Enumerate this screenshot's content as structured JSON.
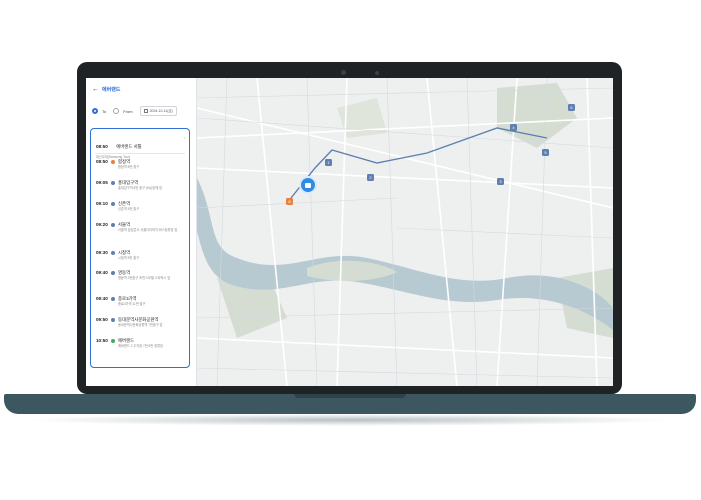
{
  "header": {
    "back_icon": "arrow-left-icon",
    "title": "에버랜드"
  },
  "filters": {
    "to_label": "To",
    "from_label": "From",
    "date_value": "2024-10-11(금)",
    "selected": "To"
  },
  "route": {
    "start": {
      "time": "08:50",
      "name": "에버랜드 서틀",
      "desc": "대산우대(Samsung Tour)"
    },
    "stops": [
      {
        "time": "08:50",
        "name": "합정역",
        "desc": "합정역 8번 출구",
        "color": "#e9803d"
      },
      {
        "time": "09:05",
        "name": "홍대입구역",
        "desc": "홍대입구역 8번 출구 (KA)앞에 정",
        "color": "#5f7fb0"
      },
      {
        "time": "09:10",
        "name": "신촌역",
        "desc": "신촌역 5번 출구",
        "color": "#5f7fb0"
      },
      {
        "time": "09:20",
        "name": "서울역",
        "desc": "서울역 빌딩콘으 서울다리하차 버스정류장 앞",
        "color": "#5f7fb0"
      },
      {
        "time": "09:30",
        "name": "시청역",
        "desc": "시청역 5번 출구",
        "color": "#5f7fb0"
      },
      {
        "time": "09:40",
        "name": "명동역",
        "desc": "명동역 2번출구 조핀스모텔 스타벅스 앞",
        "color": "#5f7fb0"
      },
      {
        "time": "09:40",
        "name": "종로3가역",
        "desc": "종로3가역 11번 출구",
        "color": "#5f7fb0"
      },
      {
        "time": "09:50",
        "name": "동대문역사문화공원역",
        "desc": "동대문역사문화공원역 7번출구 앞",
        "color": "#5f7fb0"
      },
      {
        "time": "10:50",
        "name": "에버랜드",
        "desc": "에버랜드 2 주차장 7번 8번 정류장",
        "color": "#3fae5c"
      }
    ]
  },
  "map": {
    "markers": [
      {
        "label": "1",
        "color": "grey"
      },
      {
        "label": "2",
        "color": "grey"
      },
      {
        "label": "3",
        "color": "grey"
      },
      {
        "label": "4",
        "color": "grey"
      },
      {
        "label": "5",
        "color": "grey"
      },
      {
        "label": "6",
        "color": "grey"
      },
      {
        "label": "8",
        "color": "orange"
      }
    ],
    "bus_marker_icon": "bus-icon"
  },
  "colors": {
    "accent": "#2f6fd8",
    "river": "#b7cad1",
    "park": "#d5ddd2",
    "map_bg": "#eef0ef",
    "laptop": "#1f2326",
    "base": "#3d5760"
  }
}
